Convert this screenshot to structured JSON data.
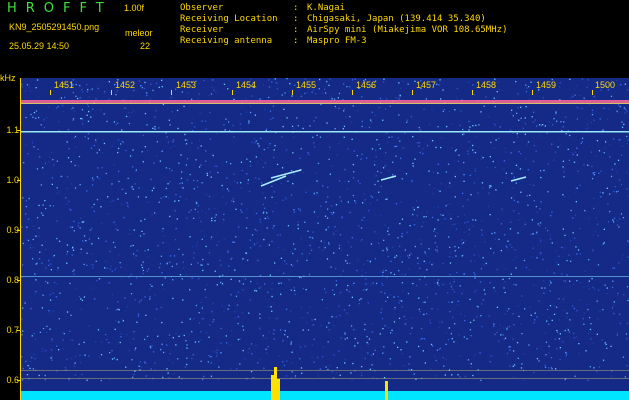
{
  "header": {
    "app_title": "HROFFT",
    "version": "1.00f",
    "filename": "KN9_2505291450.png",
    "mode": "meleor",
    "datetime": "25.05.29 14:50",
    "count": "22"
  },
  "info": [
    {
      "key": "Observer",
      "value": "K.Nagai"
    },
    {
      "key": "Receiving Location",
      "value": "Chigasaki, Japan (139.414 35.340)"
    },
    {
      "key": "Receiver",
      "value": "AirSpy mini (Miakejima VOR 108.65MHz)"
    },
    {
      "key": "Receiving antenna",
      "value": "Maspro FM-3"
    }
  ],
  "axis": {
    "unit": "kHz",
    "y_ticks": [
      "1.1",
      "1.0",
      "0.9",
      "0.8",
      "0.7",
      "0.6"
    ],
    "x_ticks": [
      "1451",
      "1452",
      "1453",
      "1454",
      "1455",
      "1456",
      "1457",
      "1458",
      "1459",
      "1500"
    ]
  },
  "colors": {
    "text": "#ffd800",
    "background": "#142a86",
    "title": "#3ee03e",
    "strip": "#00e5ff"
  }
}
